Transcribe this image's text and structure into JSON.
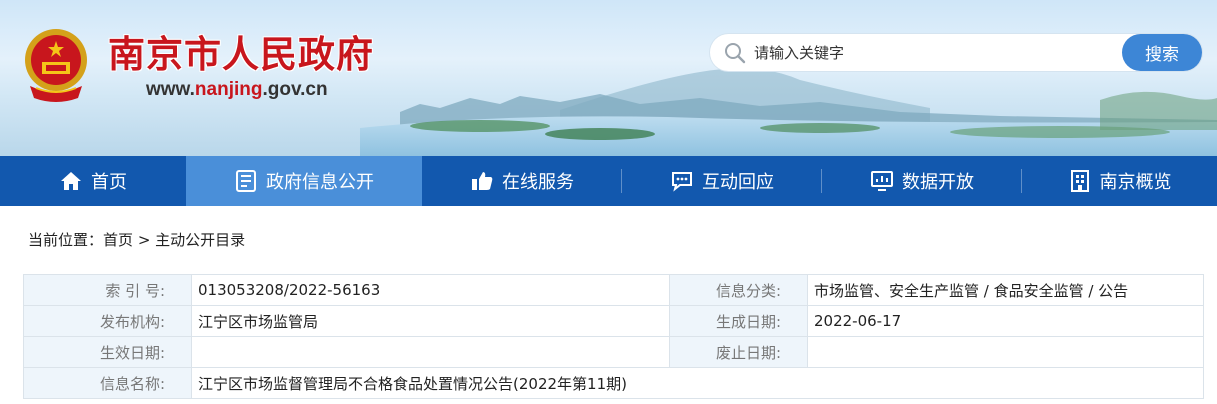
{
  "header": {
    "site_title": "南京市人民政府",
    "url_prefix": "www.",
    "url_highlight": "nanjing",
    "url_suffix": ".gov.cn",
    "emblem_icon": "national-emblem-icon"
  },
  "search": {
    "placeholder": "请输入关键字",
    "button_label": "搜索",
    "icon": "search-icon"
  },
  "nav": {
    "items": [
      {
        "label": "首页",
        "icon": "home-icon",
        "active": false
      },
      {
        "label": "政府信息公开",
        "icon": "document-icon",
        "active": true
      },
      {
        "label": "在线服务",
        "icon": "thumbs-up-icon",
        "active": false
      },
      {
        "label": "互动回应",
        "icon": "chat-icon",
        "active": false
      },
      {
        "label": "数据开放",
        "icon": "data-chart-icon",
        "active": false
      },
      {
        "label": "南京概览",
        "icon": "building-icon",
        "active": false
      }
    ]
  },
  "breadcrumb": {
    "prefix": "当前位置：",
    "home": "首页",
    "separator": ">",
    "current": "主动公开目录"
  },
  "info": {
    "index_label": "索 引 号:",
    "index_value": "013053208/2022-56163",
    "category_label": "信息分类:",
    "category_value": "市场监管、安全生产监管 / 食品安全监管 / 公告",
    "publisher_label": "发布机构:",
    "publisher_value": "江宁区市场监管局",
    "created_label": "生成日期:",
    "created_value": "2022-06-17",
    "effective_label": "生效日期:",
    "effective_value": "",
    "expiry_label": "废止日期:",
    "expiry_value": "",
    "name_label": "信息名称:",
    "name_value": "江宁区市场监督管理局不合格食品处置情况公告(2022年第11期)"
  },
  "colors": {
    "title_red": "#c8161d",
    "nav_blue": "#1258ae",
    "nav_active": "#4a8fd9",
    "search_button": "#3d86d6",
    "label_bg": "#eef5fb"
  }
}
